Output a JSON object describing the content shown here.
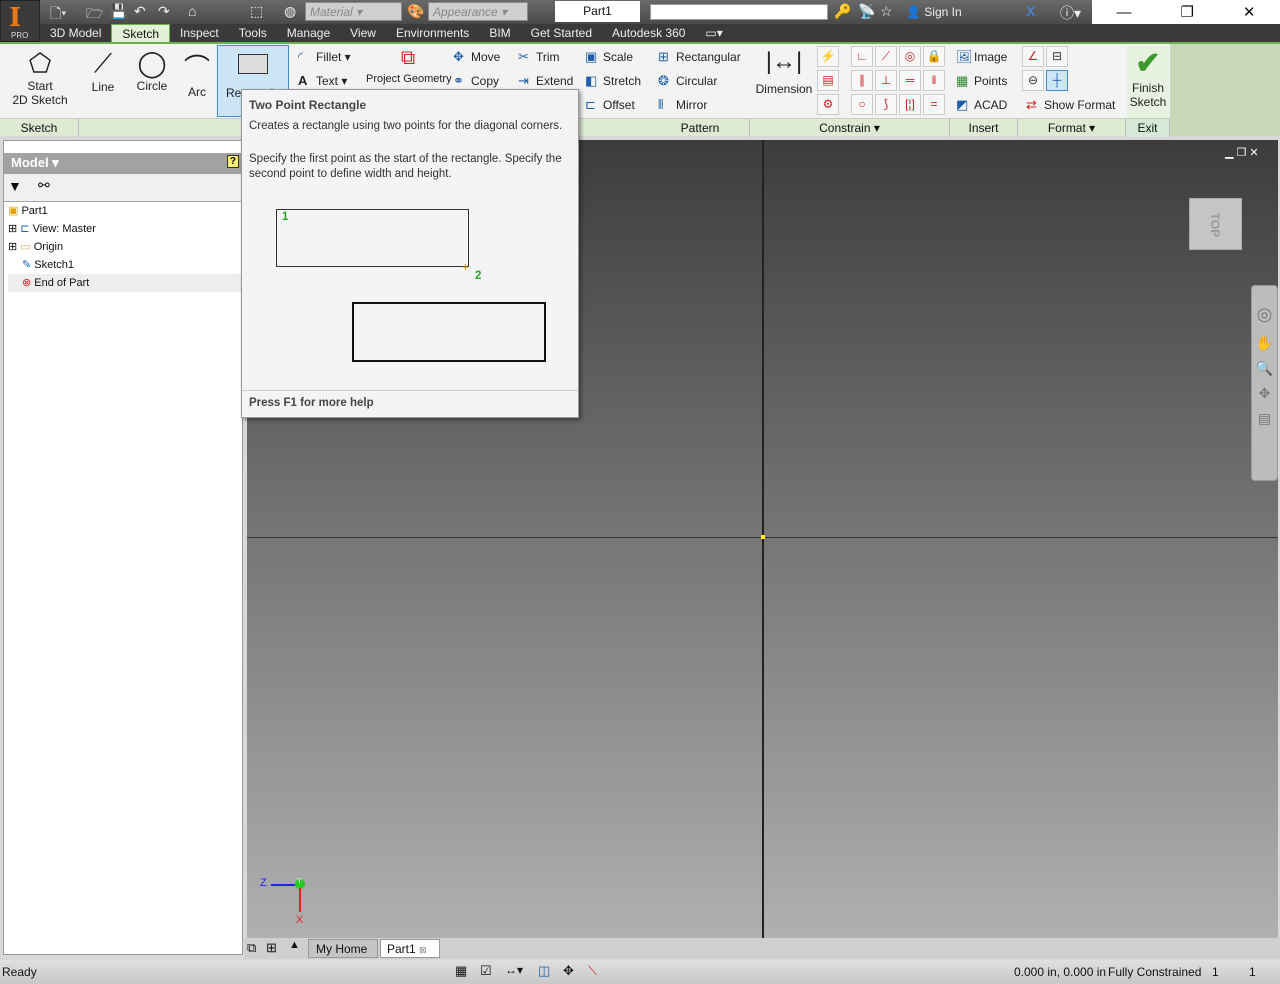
{
  "app": {
    "edition": "PRO",
    "document_title": "Part1",
    "sign_in": "Sign In",
    "material_placeholder": "Material",
    "appearance_placeholder": "Appearance"
  },
  "tabs": [
    "3D Model",
    "Sketch",
    "Inspect",
    "Tools",
    "Manage",
    "View",
    "Environments",
    "BIM",
    "Get Started",
    "Autodesk 360"
  ],
  "active_tab": "Sketch",
  "ribbon": {
    "sketch_panel": {
      "start_label": "Start",
      "start_label2": "2D Sketch",
      "label": "Sketch"
    },
    "create": {
      "line": "Line",
      "circle": "Circle",
      "arc": "Arc",
      "rectangle": "Rectangle",
      "fillet": "Fillet",
      "text": "Text",
      "project": "Project Geometry"
    },
    "modify": {
      "move": "Move",
      "copy": "Copy",
      "trim": "Trim",
      "extend": "Extend",
      "scale": "Scale",
      "stretch": "Stretch",
      "offset": "Offset"
    },
    "pattern": {
      "rectangular": "Rectangular",
      "circular": "Circular",
      "mirror": "Mirror",
      "label": "Pattern"
    },
    "constrain": {
      "dimension": "Dimension",
      "label": "Constrain"
    },
    "insert": {
      "image": "Image",
      "points": "Points",
      "acad": "ACAD",
      "label": "Insert"
    },
    "format": {
      "show_format": "Show Format",
      "label": "Format"
    },
    "exit": {
      "finish": "Finish",
      "finish2": "Sketch",
      "label": "Exit"
    }
  },
  "tooltip": {
    "title": "Two Point Rectangle",
    "desc": "Creates a rectangle using two points for the diagonal corners.",
    "detail": "Specify the first point as the start of the rectangle. Specify the second point to define width and height.",
    "p1": "1",
    "p2": "2",
    "footer": "Press F1 for more help"
  },
  "browser": {
    "title": "Model",
    "items": [
      {
        "label": "Part1"
      },
      {
        "label": "View: Master"
      },
      {
        "label": "Origin"
      },
      {
        "label": "Sketch1"
      },
      {
        "label": "End of Part"
      }
    ]
  },
  "viewcube": {
    "face": "TOP"
  },
  "triad": {
    "z": "Z",
    "y": "Y",
    "x": "X"
  },
  "doc_tabs": [
    "My Home",
    "Part1"
  ],
  "status": {
    "text": "Ready",
    "coords": "0.000 in, 0.000 in",
    "constraint": "Fully Constrained",
    "n1": "1",
    "n2": "1"
  },
  "colors": {
    "ribbon_accent": "#6ab04c",
    "axis_origin": "#ffff00"
  }
}
